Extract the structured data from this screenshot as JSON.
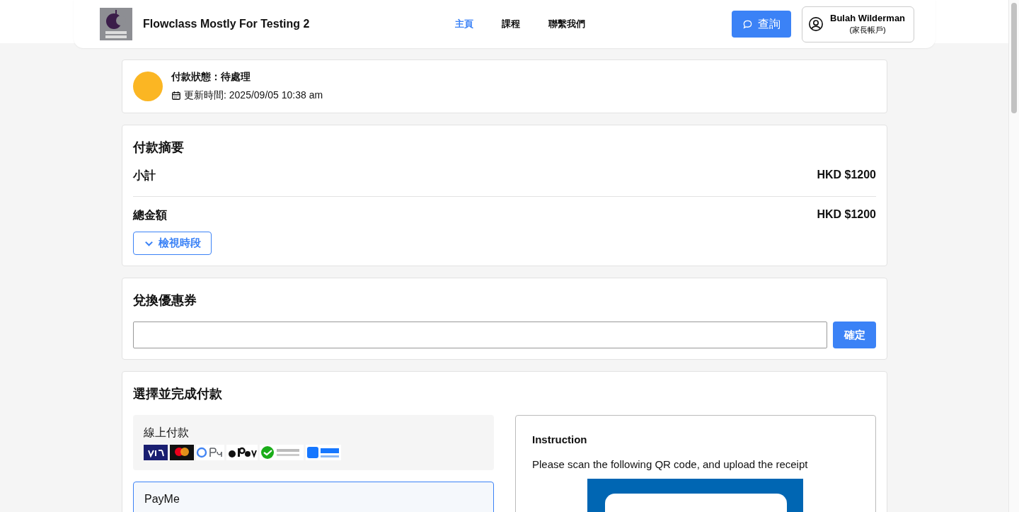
{
  "header": {
    "brand": "Flowclass Mostly For Testing 2",
    "nav": [
      {
        "label": "主頁",
        "selected": true
      },
      {
        "label": "課程",
        "selected": false
      },
      {
        "label": "聯繫我們",
        "selected": false
      }
    ],
    "enquiry_button": "查詢",
    "account": {
      "name": "Bulah Wilderman",
      "role": "(家長帳戶)"
    }
  },
  "status": {
    "title": "付款狀態：待處理",
    "color": "#fbb623",
    "updated": "更新時間: 2025/09/05 10:38 am"
  },
  "summary": {
    "title": "付款摘要",
    "rows": [
      {
        "label": "小計",
        "amount": "HKD $1200"
      },
      {
        "label": "總金額",
        "amount": "HKD $1200"
      }
    ],
    "toggle": {
      "label": "檢視時段",
      "expanded": false
    }
  },
  "coupon": {
    "title": "兌換優惠券",
    "button": "確定"
  },
  "payment": {
    "title": "選擇並完成付款",
    "methods": [
      {
        "label": "線上付款",
        "selected": false,
        "logos": true
      },
      {
        "label": "PayMe",
        "selected": true,
        "logos": false
      }
    ],
    "instruction": {
      "title": "Instruction",
      "text": "Please scan the following QR code, and upload the receipt"
    }
  }
}
